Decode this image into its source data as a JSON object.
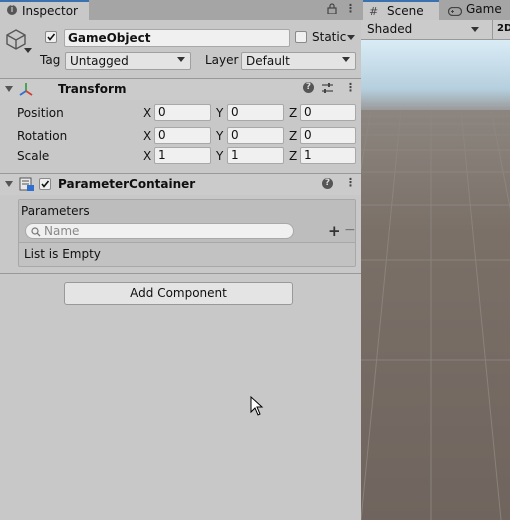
{
  "inspector": {
    "tab_label": "Inspector",
    "object": {
      "name": "GameObject",
      "static_label": "Static",
      "tag_label": "Tag",
      "tag_value": "Untagged",
      "layer_label": "Layer",
      "layer_value": "Default"
    },
    "transform": {
      "title": "Transform",
      "rows": [
        {
          "label": "Position",
          "x": "0",
          "y": "0",
          "z": "0"
        },
        {
          "label": "Rotation",
          "x": "0",
          "y": "0",
          "z": "0"
        },
        {
          "label": "Scale",
          "x": "1",
          "y": "1",
          "z": "1"
        }
      ],
      "axis_x": "X",
      "axis_y": "Y",
      "axis_z": "Z"
    },
    "parameter_container": {
      "title": "ParameterContainer",
      "list_header": "Parameters",
      "search_placeholder": "Name",
      "add_symbol": "+",
      "remove_symbol": "−",
      "empty_text": "List is Empty"
    },
    "add_component_label": "Add Component"
  },
  "scene": {
    "tab_scene": "Scene",
    "tab_game": "Game",
    "shading_mode": "Shaded",
    "mode_2d": "2D"
  },
  "colors": {
    "accent": "#3a72b0",
    "panel_bg": "#c8c8c8",
    "sky_top": "#d9ecf6",
    "ground": "#7a7068"
  },
  "icons": [
    "inspector-tab-icon",
    "lock-icon",
    "more-menu-icon",
    "cube-icon",
    "transform-icon",
    "help-icon",
    "presets-icon",
    "script-icon",
    "search-icon",
    "add-icon",
    "remove-icon",
    "grid-icon",
    "gamepad-icon",
    "mouse-cursor-icon"
  ]
}
